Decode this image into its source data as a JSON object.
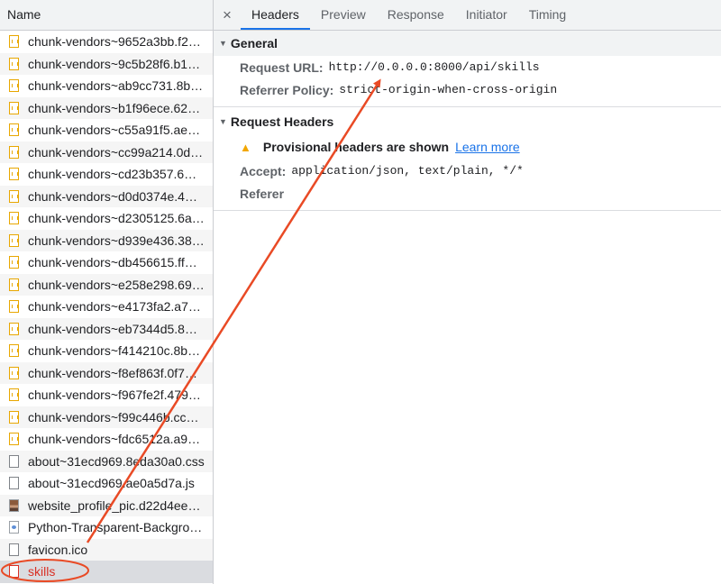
{
  "sidebar": {
    "header": "Name",
    "rows": [
      {
        "name": "chunk-vendors~9652a3bb.f2…",
        "icon": "script-file-icon"
      },
      {
        "name": "chunk-vendors~9c5b28f6.b1…",
        "icon": "script-file-icon"
      },
      {
        "name": "chunk-vendors~ab9cc731.8b…",
        "icon": "script-file-icon"
      },
      {
        "name": "chunk-vendors~b1f96ece.62…",
        "icon": "script-file-icon"
      },
      {
        "name": "chunk-vendors~c55a91f5.ae…",
        "icon": "script-file-icon"
      },
      {
        "name": "chunk-vendors~cc99a214.0d…",
        "icon": "script-file-icon"
      },
      {
        "name": "chunk-vendors~cd23b357.6…",
        "icon": "script-file-icon"
      },
      {
        "name": "chunk-vendors~d0d0374e.4…",
        "icon": "script-file-icon"
      },
      {
        "name": "chunk-vendors~d2305125.6a…",
        "icon": "script-file-icon"
      },
      {
        "name": "chunk-vendors~d939e436.38…",
        "icon": "script-file-icon"
      },
      {
        "name": "chunk-vendors~db456615.ff…",
        "icon": "script-file-icon"
      },
      {
        "name": "chunk-vendors~e258e298.69…",
        "icon": "script-file-icon"
      },
      {
        "name": "chunk-vendors~e4173fa2.a7…",
        "icon": "script-file-icon"
      },
      {
        "name": "chunk-vendors~eb7344d5.8…",
        "icon": "script-file-icon"
      },
      {
        "name": "chunk-vendors~f414210c.8b…",
        "icon": "script-file-icon"
      },
      {
        "name": "chunk-vendors~f8ef863f.0f7…",
        "icon": "script-file-icon"
      },
      {
        "name": "chunk-vendors~f967fe2f.479…",
        "icon": "script-file-icon"
      },
      {
        "name": "chunk-vendors~f99c446b.cc…",
        "icon": "script-file-icon"
      },
      {
        "name": "chunk-vendors~fdc6512a.a9…",
        "icon": "script-file-icon"
      },
      {
        "name": "about~31ecd969.8eda30a0.css",
        "icon": "document-file-icon"
      },
      {
        "name": "about~31ecd969.ae0a5d7a.js",
        "icon": "document-file-icon"
      },
      {
        "name": "website_profile_pic.d22d4ee…",
        "icon": "image-thumbnail-icon"
      },
      {
        "name": "Python-Transparent-Backgro…",
        "icon": "image-file-icon"
      },
      {
        "name": "favicon.ico",
        "icon": "document-file-icon"
      },
      {
        "name": "skills",
        "icon": "error-file-icon",
        "status": "error",
        "selected": true
      }
    ]
  },
  "tabs": {
    "close_label": "×",
    "items": [
      "Headers",
      "Preview",
      "Response",
      "Initiator",
      "Timing"
    ],
    "active": "Headers"
  },
  "general": {
    "title": "General",
    "request_url_label": "Request URL:",
    "request_url": "http://0.0.0.0:8000/api/skills",
    "referrer_policy_label": "Referrer Policy:",
    "referrer_policy": "strict-origin-when-cross-origin"
  },
  "request_headers": {
    "title": "Request Headers",
    "warning_icon": "warning-icon",
    "warning_text": "Provisional headers are shown",
    "learn_more": "Learn more",
    "accept_label": "Accept:",
    "accept_value": "application/json, text/plain, */*",
    "referer_label": "Referer"
  },
  "colors": {
    "annotation": "#e94a25",
    "error_text": "#d93025",
    "link": "#1a73e8",
    "warning": "#f2a600"
  }
}
